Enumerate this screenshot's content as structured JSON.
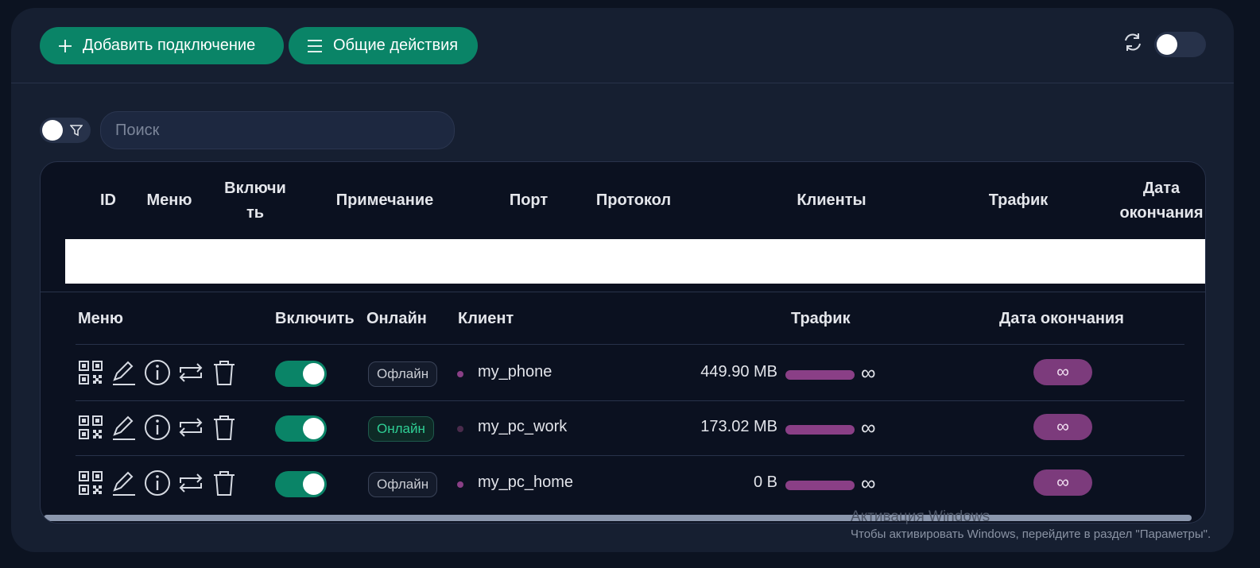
{
  "toolbar": {
    "add_label": "Добавить подключение",
    "general_label": "Общие действия"
  },
  "search": {
    "placeholder": "Поиск",
    "value": ""
  },
  "table": {
    "headers": {
      "id": "ID",
      "menu": "Меню",
      "enable_1": "Включи",
      "enable_2": "ть",
      "remark": "Примечание",
      "port": "Порт",
      "protocol": "Протокол",
      "clients": "Клиенты",
      "traffic": "Трафик",
      "expiry_1": "Дата",
      "expiry_2": "окончания"
    }
  },
  "clients_table": {
    "headers": {
      "menu": "Меню",
      "enable": "Включить",
      "online": "Онлайн",
      "client": "Клиент",
      "traffic": "Трафик",
      "expiry": "Дата окончания"
    },
    "rows": [
      {
        "status": "Офлайн",
        "online": false,
        "name": "my_phone",
        "traffic": "449.90 MB",
        "limit": "∞",
        "expiry": "∞",
        "enabled": true
      },
      {
        "status": "Онлайн",
        "online": true,
        "name": "my_pc_work",
        "traffic": "173.02 MB",
        "limit": "∞",
        "expiry": "∞",
        "enabled": true
      },
      {
        "status": "Офлайн",
        "online": false,
        "name": "my_pc_home",
        "traffic": "0 B",
        "limit": "∞",
        "expiry": "∞",
        "enabled": true
      }
    ]
  },
  "watermark": {
    "title": "Активация Windows",
    "subtitle": "Чтобы активировать Windows, перейдите в раздел \"Параметры\"."
  },
  "colors": {
    "accent_green": "#0a8467",
    "accent_purple": "#7c3b7c",
    "online_green": "#2fcf95",
    "card_bg": "#161f31",
    "table_bg": "#0b1120"
  },
  "icons": [
    "plus-icon",
    "menu-lines-icon",
    "reload-icon",
    "filter-icon",
    "qrcode-icon",
    "edit-icon",
    "info-icon",
    "reset-icon",
    "delete-icon"
  ]
}
